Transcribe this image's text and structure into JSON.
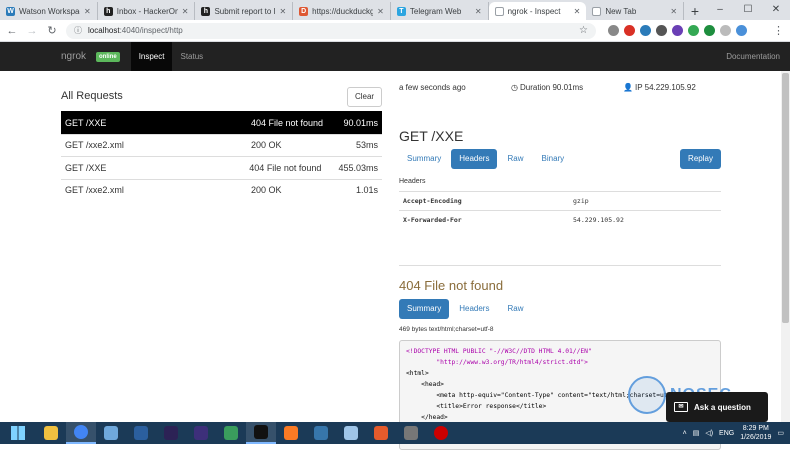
{
  "browser": {
    "tabs": [
      {
        "title": "Watson Workspace",
        "favicon_color": "#2b7bb9",
        "favicon_glyph": "W",
        "active": false
      },
      {
        "title": "Inbox - HackerOne",
        "favicon_color": "#222222",
        "favicon_glyph": "h",
        "active": false
      },
      {
        "title": "Submit report to D",
        "favicon_color": "#222222",
        "favicon_glyph": "h",
        "active": false
      },
      {
        "title": "https://duckduckgo",
        "favicon_color": "#de5833",
        "favicon_glyph": "D",
        "active": false
      },
      {
        "title": "Telegram Web",
        "favicon_color": "#2ca5e0",
        "favicon_glyph": "T",
        "active": false
      },
      {
        "title": "ngrok - Inspect",
        "favicon_color": "#ffffff",
        "favicon_glyph": "",
        "active": true
      },
      {
        "title": "New Tab",
        "favicon_color": "#ffffff",
        "favicon_glyph": "",
        "active": false
      }
    ],
    "new_tab_glyph": "+",
    "window_controls": [
      "–",
      "☐",
      "✕"
    ],
    "url_host": "localhost",
    "url_path": ":4040/inspect/http"
  },
  "ngrok": {
    "brand": "ngrok",
    "status_badge": "online",
    "nav_inspect": "Inspect",
    "nav_status": "Status",
    "nav_docs": "Documentation"
  },
  "requests": {
    "heading": "All Requests",
    "clear_label": "Clear",
    "rows": [
      {
        "request": "GET /XXE",
        "status": "404 File not found",
        "duration": "90.01ms",
        "selected": true
      },
      {
        "request": "GET /xxe2.xml",
        "status": "200 OK",
        "duration": "53ms",
        "selected": false
      },
      {
        "request": "GET /XXE",
        "status": "404 File not found",
        "duration": "455.03ms",
        "selected": false
      },
      {
        "request": "GET /xxe2.xml",
        "status": "200 OK",
        "duration": "1.01s",
        "selected": false
      }
    ]
  },
  "detail": {
    "time_ago": "a few seconds ago",
    "duration_label": "Duration",
    "duration_value": "90.01ms",
    "ip_label": "IP",
    "ip_value": "54.229.105.92",
    "request_title": "GET /XXE",
    "request_tabs": [
      "Summary",
      "Headers",
      "Raw",
      "Binary"
    ],
    "request_active_tab": "Headers",
    "replay_label": "Replay",
    "headers_label": "Headers",
    "headers": [
      {
        "key": "Accept-Encoding",
        "value": "gzip"
      },
      {
        "key": "X-Forwarded-For",
        "value": "54.229.105.92"
      }
    ],
    "response_title": "404 File not found",
    "response_tabs": [
      "Summary",
      "Headers",
      "Raw"
    ],
    "response_active_tab": "Summary",
    "response_meta": "469 bytes text/html;charset=utf-8",
    "body_lines": [
      "<!DOCTYPE HTML PUBLIC \"-//W3C//DTD HTML 4.01//EN\"",
      "        \"http://www.w3.org/TR/html4/strict.dtd\">",
      "<html>",
      "    <head>",
      "        <meta http-equiv=\"Content-Type\" content=\"text/html;charset=utf-8\">",
      "        <title>Error response</title>",
      "    </head>"
    ]
  },
  "overlay": {
    "watermark": "NOSEC",
    "ask_label": "Ask a question"
  },
  "taskbar": {
    "apps": [
      {
        "name": "file-explorer",
        "color": "#f0c040"
      },
      {
        "name": "chrome",
        "color": "#4285f4"
      },
      {
        "name": "notepad",
        "color": "#6fa8dc"
      },
      {
        "name": "virtualbox",
        "color": "#2b5f9e"
      },
      {
        "name": "eclipse",
        "color": "#2c2255"
      },
      {
        "name": "eclipse-2",
        "color": "#3d2f7a"
      },
      {
        "name": "app-green",
        "color": "#3a9d5d"
      },
      {
        "name": "terminal",
        "color": "#111111"
      },
      {
        "name": "xampp",
        "color": "#fb7a24"
      },
      {
        "name": "python",
        "color": "#3776ab"
      },
      {
        "name": "tool",
        "color": "#9fc5e8"
      },
      {
        "name": "burp",
        "color": "#e55b2c"
      },
      {
        "name": "app-gray",
        "color": "#777777"
      },
      {
        "name": "record",
        "color": "#cc0000"
      }
    ],
    "language": "ENG",
    "time": "8:29 PM",
    "date": "1/26/2019"
  }
}
